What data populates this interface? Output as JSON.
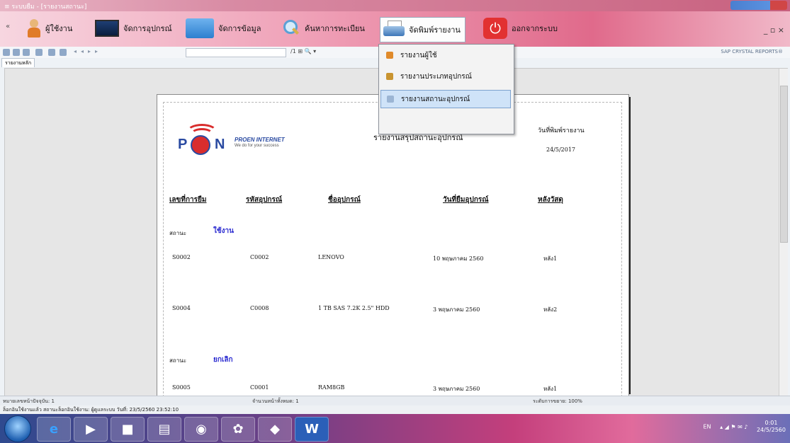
{
  "window": {
    "title": "≡ ระบบยืม - [รายงานสถานะ]"
  },
  "menu": {
    "users_label": "ผู้ใช้งาน",
    "devices_label": "จัดการอุปกรณ์",
    "data_label": "จัดการข้อมูล",
    "search_label": "ค้นหาการทะเบียน",
    "print_label": "จัดพิมพ์รายงาน",
    "exit_label": "ออกจากระบบ",
    "window_controls": "_ ▫ ×"
  },
  "dropdown": {
    "items": [
      {
        "label": "รายงานผู้ใช้"
      },
      {
        "label": "รายงานประเภทอุปกรณ์"
      },
      {
        "label": "รายงานสถานะอุปกรณ์"
      }
    ]
  },
  "toolbar": {
    "page_count": "/1  ⊞  🔍 ▾",
    "crystal_label": "SAP CRYSTAL REPORTS®"
  },
  "tab": {
    "label": "รายงานหลัก"
  },
  "report": {
    "logo_brand": "PROEN INTERNET",
    "logo_tagline": "We do for your success",
    "logo_letters": {
      "p": "P",
      "n": "N"
    },
    "title": "รายงานสรุปสถานะอุปกรณ์",
    "print_date_label": "วันที่พิมพ์รายงาน",
    "print_date": "24/5/2017",
    "columns": [
      "เลขที่การยืม",
      "รหัสอุปกรณ์",
      "ชื่ออุปกรณ์",
      "วันที่ยืมอุปกรณ์",
      "หลังวัสดุ"
    ],
    "groups": [
      {
        "status_label": "สถานะ",
        "status": "ใช้งาน",
        "rows": [
          [
            "S0002",
            "C0002",
            "LENOVO",
            "10 พฤษภาคม 2560",
            "หลัง1"
          ],
          [
            "S0004",
            "C0008",
            "1 TB SAS 7.2K 2.5\" HDD",
            "3 พฤษภาคม 2560",
            "หลัง2"
          ]
        ]
      },
      {
        "status_label": "สถานะ",
        "status": "ยกเลิก",
        "rows": [
          [
            "S0005",
            "C0001",
            "RAM8GB",
            "3 พฤษภาคม 2560",
            "หลัง1"
          ]
        ]
      }
    ]
  },
  "status": {
    "current_page": "หมายเลขหน้าปัจจุบัน: 1",
    "total_pages": "จำนวนหน้าทั้งหมด: 1",
    "zoom": "ระดับการขยาย: 100%",
    "info": "ล็อกอินใช้งานแล้ว  สถานะล็อกอินใช้งาน:  ผู้ดูแลระบบ  วันที่: 23/5/2560 23:52:10"
  },
  "taskbar": {
    "tray_lang": "EN",
    "time": "0:01",
    "date": "24/5/2560"
  }
}
